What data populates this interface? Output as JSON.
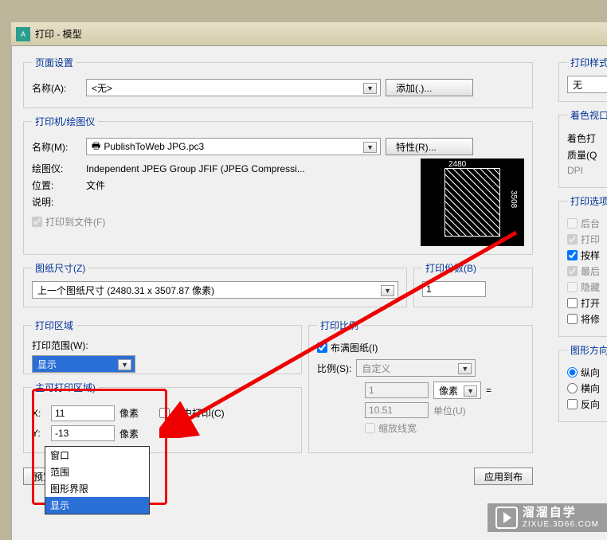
{
  "window": {
    "title": "打印 - 模型"
  },
  "page_setup": {
    "legend": "页面设置",
    "name_label": "名称(A):",
    "name_value": "<无>",
    "add_btn": "添加(.)..."
  },
  "printer": {
    "legend": "打印机/绘图仪",
    "name_label": "名称(M):",
    "name_value": "PublishToWeb JPG.pc3",
    "props_btn": "特性(R)...",
    "plotter_label": "绘图仪:",
    "plotter_value": "Independent JPEG Group JFIF (JPEG Compressi...",
    "location_label": "位置:",
    "location_value": "文件",
    "desc_label": "说明:",
    "print_to_file": "打印到文件(F)",
    "preview_w": "2480",
    "preview_h": "3508"
  },
  "paper": {
    "legend": "图纸尺寸(Z)",
    "value": "上一个图纸尺寸  (2480.31 x 3507.87 像素)"
  },
  "copies": {
    "legend": "打印份数(B)",
    "value": "1"
  },
  "area": {
    "legend": "打印区域",
    "range_label": "打印范围(W):",
    "selected": "显示",
    "options": [
      "窗口",
      "范围",
      "图形界限",
      "显示"
    ]
  },
  "offset": {
    "legend_partial": "主可打印区域)",
    "x_label": "X:",
    "x_value": "11",
    "y_label": "Y:",
    "y_value": "-13",
    "unit": "像素",
    "center": "居中打印(C)"
  },
  "scale": {
    "legend": "打印比例",
    "fit": "布满图纸(I)",
    "ratio_label": "比例(S):",
    "ratio_value": "自定义",
    "num1": "1",
    "unit1": "像素",
    "eq": "=",
    "num2": "10.51",
    "unit2_label": "单位(U)",
    "scale_lw": "缩放线宽"
  },
  "style": {
    "legend": "打印样式",
    "value": "无"
  },
  "shade": {
    "legend": "着色视口",
    "shade_label": "着色打",
    "quality_label": "质量(Q",
    "dpi_label": "DPI"
  },
  "options": {
    "legend": "打印选项",
    "bg": "后台",
    "print": "打印",
    "bystyle": "按样",
    "last": "最后",
    "hide": "隐藏",
    "open": "打开",
    "save": "将修"
  },
  "orient": {
    "legend": "图形方向",
    "portrait": "纵向",
    "landscape": "横向",
    "reverse": "反向"
  },
  "footer": {
    "preview": "预览(P)...",
    "apply": "应用到布"
  },
  "watermark": {
    "cn": "溜溜自学",
    "en": "ZIXUE.3D66.COM"
  }
}
